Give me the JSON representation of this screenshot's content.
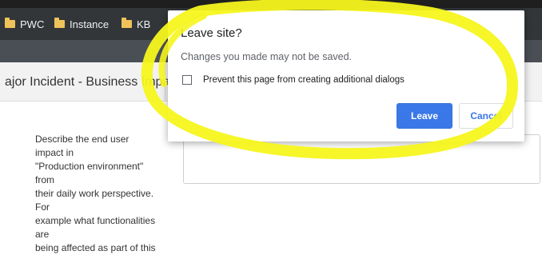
{
  "bookmarks_bar": {
    "items": [
      {
        "label": "PWC",
        "icon": "folder-icon"
      },
      {
        "label": "Instance",
        "icon": "folder-icon"
      },
      {
        "label": "KB",
        "icon": "folder-icon"
      }
    ]
  },
  "page": {
    "title": "ajor Incident - Business Impac",
    "description_lines": [
      "Describe the end user impact in",
      "\"Production environment\" from",
      "their daily work perspective. For",
      "example what functionalities are",
      "being affected as part of this"
    ]
  },
  "dialog": {
    "title": "Leave site?",
    "message": "Changes you made may not be saved.",
    "checkbox_label": "Prevent this page from creating additional dialogs",
    "checkbox_checked": false,
    "leave_label": "Leave",
    "cancel_label": "Cancel"
  },
  "colors": {
    "annotation": "#f5f51e",
    "leave_button": "#3b78e7",
    "bookmarks_bar": "#323639"
  }
}
